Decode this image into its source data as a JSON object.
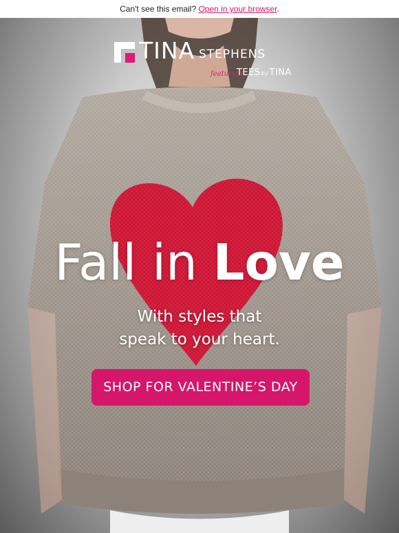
{
  "topbar": {
    "prefix": "Can't see this email?",
    "link_label": "Open in your browser",
    "suffix": "."
  },
  "logo": {
    "brand_primary": "TINA",
    "brand_secondary": "STEPHENS",
    "featuring": "featuring",
    "sub_brand_1": "TEES",
    "sub_brand_by": "by",
    "sub_brand_2": "TINA",
    "colors": {
      "mark_pink": "#e0187a",
      "mark_white": "#ffffff"
    }
  },
  "hero": {
    "headline_light": "Fall in ",
    "headline_bold": "Love",
    "subhead_line1": "With styles that",
    "subhead_line2": "speak to your heart.",
    "cta_label": "SHOP FOR VALENTINE’S DAY",
    "image_description_icon": "sweater-with-red-heart-photo"
  },
  "colors": {
    "accent": "#d6166a",
    "link": "#d6166a",
    "heart": "#d9203f",
    "sweater": "#a59b93"
  }
}
